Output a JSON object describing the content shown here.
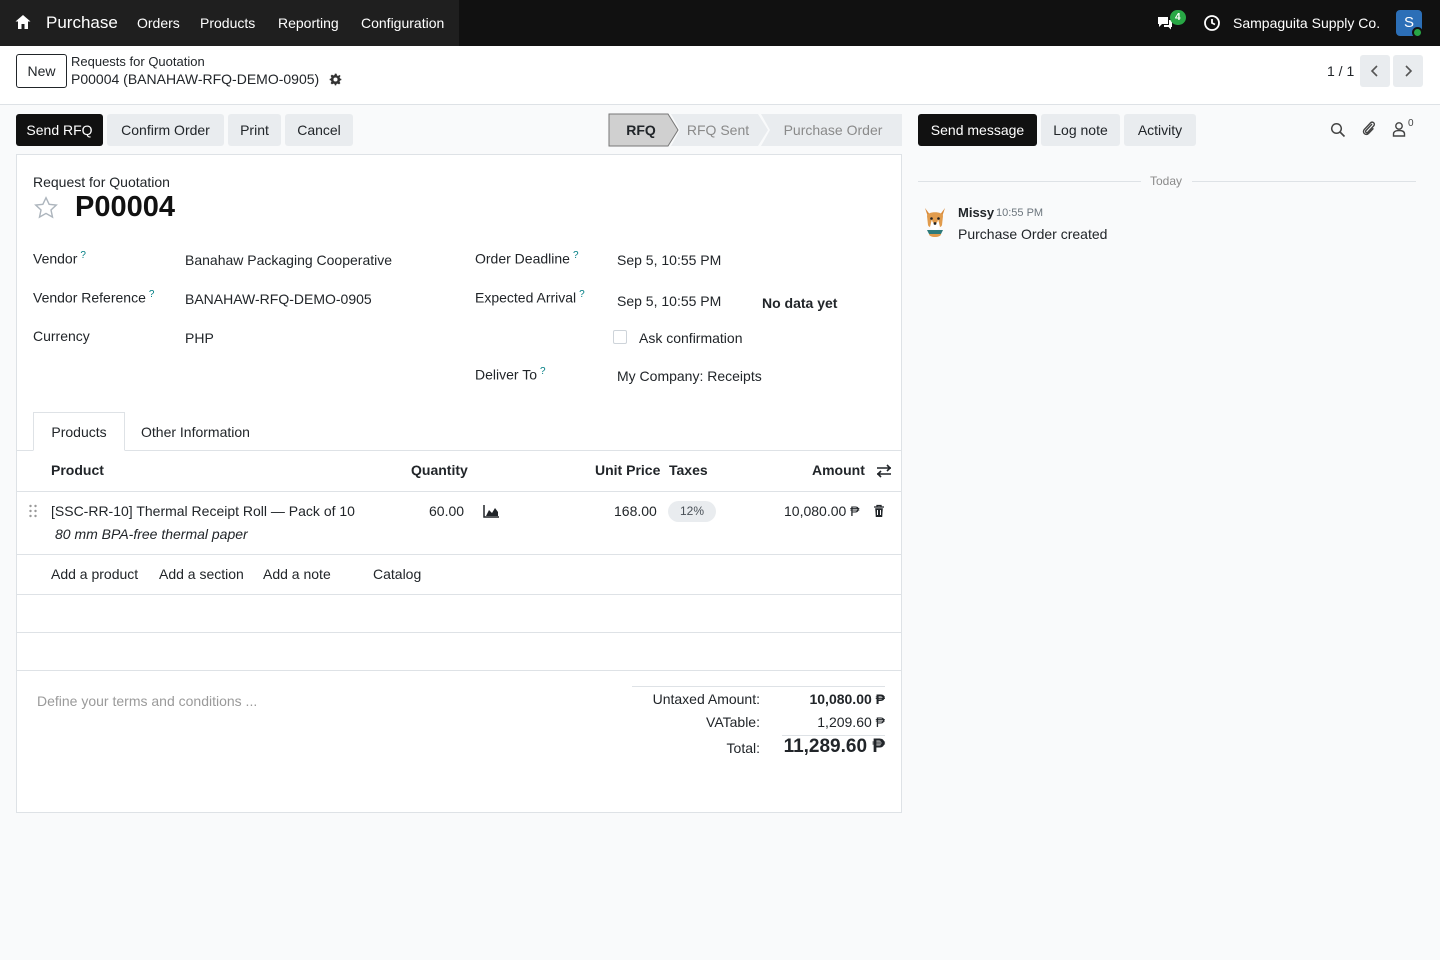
{
  "navbar": {
    "app_name": "Purchase",
    "menu": [
      "Orders",
      "Products",
      "Reporting",
      "Configuration"
    ],
    "messages_count": "4",
    "company": "Sampaguita Supply Co.",
    "user_initial": "S"
  },
  "control_panel": {
    "new_label": "New",
    "breadcrumb_parent": "Requests for Quotation",
    "breadcrumb_current": "P00004 (BANAHAW-RFQ-DEMO-0905)",
    "pager": "1 / 1"
  },
  "actions": {
    "send_rfq": "Send RFQ",
    "confirm_order": "Confirm Order",
    "print": "Print",
    "cancel": "Cancel"
  },
  "status": {
    "stages": [
      "RFQ",
      "RFQ Sent",
      "Purchase Order"
    ],
    "current": "RFQ"
  },
  "form": {
    "doc_type": "Request for Quotation",
    "name": "P00004",
    "fields_left": [
      {
        "label": "Vendor",
        "help": "?",
        "value": "Banahaw Packaging Cooperative"
      },
      {
        "label": "Vendor Reference",
        "help": "?",
        "value": "BANAHAW-RFQ-DEMO-0905"
      },
      {
        "label": "Currency",
        "help": "",
        "value": "PHP"
      }
    ],
    "fields_right": [
      {
        "label": "Order Deadline",
        "help": "?",
        "value": "Sep 5, 10:55 PM"
      },
      {
        "label": "Expected Arrival",
        "help": "?",
        "value": "Sep 5, 10:55 PM",
        "extra": "No data yet"
      },
      {
        "label": "Ask confirmation",
        "checked": false
      },
      {
        "label": "Deliver To",
        "help": "?",
        "value": "My Company: Receipts"
      }
    ],
    "tabs": [
      "Products",
      "Other Information"
    ],
    "active_tab": "Products",
    "columns": [
      "Product",
      "Quantity",
      "Unit Price",
      "Taxes",
      "Amount"
    ],
    "lines": [
      {
        "product": "[SSC-RR-10] Thermal Receipt Roll — Pack of 10",
        "description": "80 mm BPA-free thermal paper",
        "quantity": "60.00",
        "unit_price": "168.00",
        "taxes": "12%",
        "amount": "10,080.00 ₱"
      }
    ],
    "line_actions": [
      "Add a product",
      "Add a section",
      "Add a note",
      "Catalog"
    ],
    "terms_placeholder": "Define your terms and conditions ...",
    "totals": [
      {
        "label": "Untaxed Amount:",
        "value": "10,080.00 ₱"
      },
      {
        "label": "VATable:",
        "value": "1,209.60 ₱"
      },
      {
        "label": "Total:",
        "value": "11,289.60 ₱"
      }
    ]
  },
  "chatter": {
    "send_message": "Send message",
    "log_note": "Log note",
    "activity": "Activity",
    "followers_count": "0",
    "date_separator": "Today",
    "messages": [
      {
        "author": "Missy",
        "time": "10:55 PM",
        "body": "Purchase Order created"
      }
    ]
  }
}
